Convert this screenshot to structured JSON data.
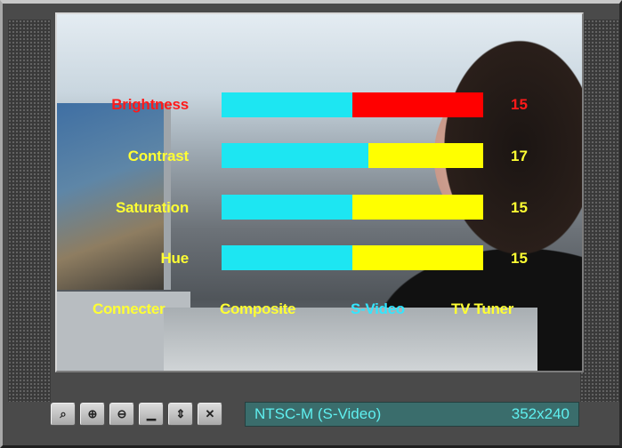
{
  "sliders": [
    {
      "label": "Brightness",
      "value": "15",
      "level_fraction": 0.5,
      "label_color": "#ff1a1a",
      "value_color": "#ff1a1a",
      "fill_color": "#ff0000"
    },
    {
      "label": "Contrast",
      "value": "17",
      "level_fraction": 0.56,
      "label_color": "#ffff33",
      "value_color": "#ffff33",
      "fill_color": "#ffff00"
    },
    {
      "label": "Saturation",
      "value": "15",
      "level_fraction": 0.5,
      "label_color": "#ffff33",
      "value_color": "#ffff33",
      "fill_color": "#ffff00"
    },
    {
      "label": "Hue",
      "value": "15",
      "level_fraction": 0.5,
      "label_color": "#ffff33",
      "value_color": "#ffff33",
      "fill_color": "#ffff00"
    }
  ],
  "slider_base_color": "#1de6f2",
  "connector": {
    "label": "Connecter",
    "options": [
      {
        "label": "Composite",
        "color": "#ffff33",
        "selected": false
      },
      {
        "label": "S-Video",
        "color": "#33e6ff",
        "selected": true
      },
      {
        "label": "TV Tuner",
        "color": "#ffff33",
        "selected": false
      }
    ]
  },
  "toolbar": {
    "buttons": [
      {
        "icon": "magnifier-icon",
        "glyph": "⌕"
      },
      {
        "icon": "zoom-in-icon",
        "glyph": "⊕"
      },
      {
        "icon": "zoom-out-icon",
        "glyph": "⊖"
      },
      {
        "icon": "minimize-icon",
        "glyph": "▁"
      },
      {
        "icon": "up-down-arrows-icon",
        "glyph": "⇕"
      },
      {
        "icon": "close-icon",
        "glyph": "✕"
      }
    ]
  },
  "status": {
    "mode": "NTSC-M (S-Video)",
    "resolution": "352x240"
  }
}
